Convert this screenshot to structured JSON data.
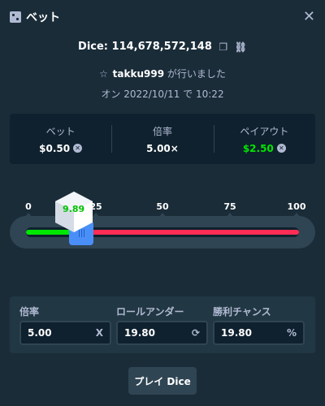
{
  "header": {
    "title": "ベット",
    "icon": "dice-game-icon",
    "close_icon": "close-icon"
  },
  "bet_info": {
    "dice_id": "Dice: 114,678,572,148",
    "copy_icon": "copy-icon",
    "link_icon": "link-icon",
    "user_prefix_icon": "star-icon",
    "username": "takku999",
    "user_suffix": "が行いました",
    "date_text": "オン 2022/10/11 で 10:22"
  },
  "stats": [
    {
      "label": "ベット",
      "value": "$0.50",
      "has_coin": true,
      "color": "#ffffff"
    },
    {
      "label": "倍率",
      "value": "5.00×",
      "has_coin": false,
      "color": "#ffffff"
    },
    {
      "label": "ペイアウト",
      "value": "$2.50",
      "has_coin": true,
      "color": "#00e701"
    }
  ],
  "slider": {
    "ticks": [
      "0",
      "25",
      "50",
      "75",
      "100"
    ],
    "roll_under": 19.8,
    "result": "9.89",
    "result_value": 9.89,
    "win_color": "#00e701",
    "lose_color": "#ff2d55"
  },
  "controls": {
    "multiplier": {
      "label": "倍率",
      "value": "5.00",
      "suffix": "X"
    },
    "roll_under": {
      "label": "ロールアンダー",
      "value": "19.80",
      "suffix_icon": "refresh-icon"
    },
    "win_chance": {
      "label": "勝利チャンス",
      "value": "19.80",
      "suffix": "%"
    }
  },
  "play_button": {
    "label": "プレイ Dice"
  }
}
